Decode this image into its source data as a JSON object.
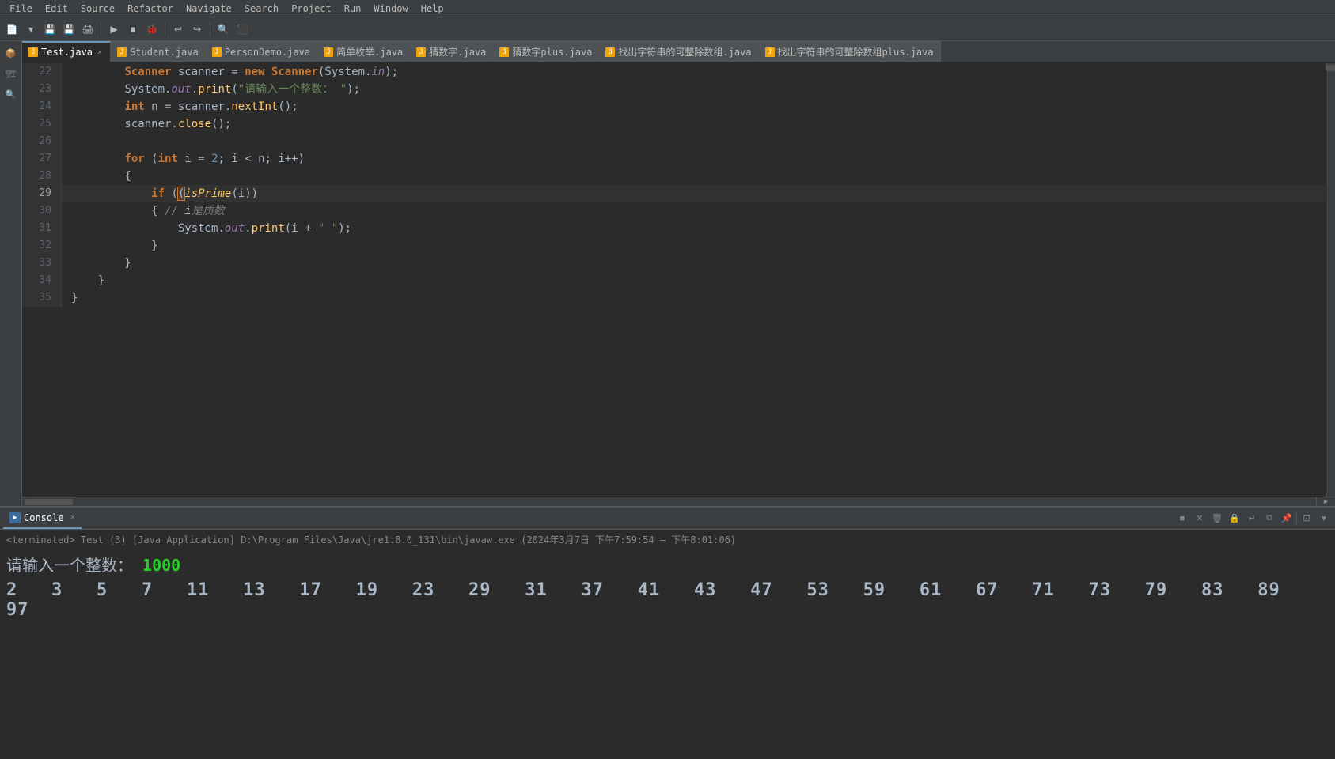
{
  "menu": {
    "items": [
      "File",
      "Edit",
      "Source",
      "Refactor",
      "Navigate",
      "Search",
      "Project",
      "Run",
      "Window",
      "Help"
    ]
  },
  "tabs": [
    {
      "label": "Test.java",
      "active": true,
      "modified": false
    },
    {
      "label": "Student.java",
      "active": false
    },
    {
      "label": "PersonDemo.java",
      "active": false
    },
    {
      "label": "简单枚举.java",
      "active": false
    },
    {
      "label": "猜数字.java",
      "active": false
    },
    {
      "label": "猜数字plus.java",
      "active": false
    },
    {
      "label": "找出字符串的可整除数组.java",
      "active": false
    },
    {
      "label": "找出字符串的可整除数组plus.java",
      "active": false
    }
  ],
  "code_lines": [
    {
      "num": "22",
      "content": "        Scanner scanner = new Scanner(System.in);"
    },
    {
      "num": "23",
      "content": "        System.out.print(\"请输入一个整数：\");"
    },
    {
      "num": "24",
      "content": "        int n = scanner.nextInt();"
    },
    {
      "num": "25",
      "content": "        scanner.close();"
    },
    {
      "num": "26",
      "content": ""
    },
    {
      "num": "27",
      "content": "        for (int i = 2; i < n; i++)"
    },
    {
      "num": "28",
      "content": "        {"
    },
    {
      "num": "29",
      "content": "            if (isPrime(i))"
    },
    {
      "num": "30",
      "content": "            { // i是质数"
    },
    {
      "num": "31",
      "content": "                System.out.print(i + \" \");"
    },
    {
      "num": "32",
      "content": "            }"
    },
    {
      "num": "33",
      "content": "        }"
    },
    {
      "num": "34",
      "content": "    }"
    },
    {
      "num": "35",
      "content": "}"
    }
  ],
  "console": {
    "tab_label": "Console",
    "terminated_text": "<terminated> Test (3) [Java Application] D:\\Program Files\\Java\\jre1.8.0_131\\bin\\javaw.exe  (2024年3月7日 下午7:59:54 – 下午8:01:06)",
    "input_label": "请输入一个整数：",
    "input_value": "1000",
    "output": "2  3  5  7  11  13  17  19  23  29  31  37  41  43  47  53  59  61  67  71  73  79  83  89  97"
  }
}
